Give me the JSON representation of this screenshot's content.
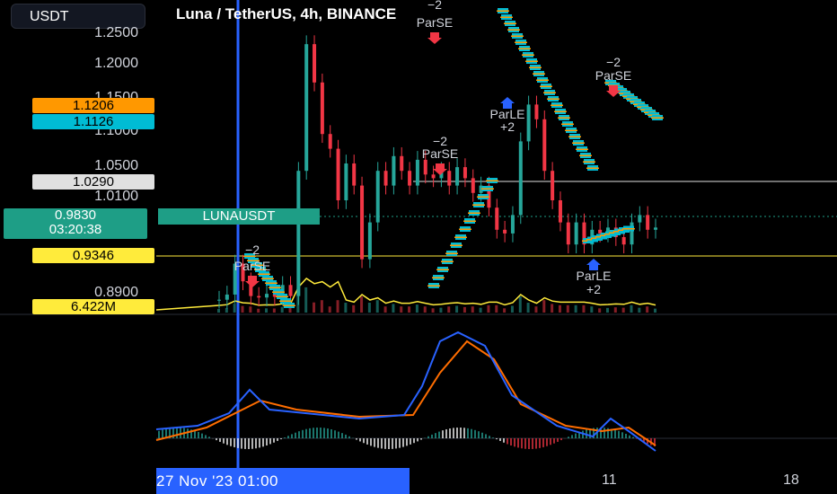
{
  "header": {
    "currency_button": "USDT",
    "title": "Luna / TetherUS, 4h, BINANCE"
  },
  "price_axis": {
    "ticks": [
      "1.2500",
      "1.2000",
      "1.1500",
      "1.1000",
      "1.0500",
      "1.0100",
      "0.8900"
    ],
    "badges": [
      {
        "label": "1.1206",
        "bg": "#ff9800",
        "fg": "#000000"
      },
      {
        "label": "1.1126",
        "bg": "#00bcd4",
        "fg": "#000000"
      },
      {
        "label": "1.0290",
        "bg": "#e0e0e0",
        "fg": "#000000"
      },
      {
        "label": "0.9346",
        "bg": "#ffeb3b",
        "fg": "#000000"
      },
      {
        "label": "6.422M",
        "bg": "#ffeb3b",
        "fg": "#000000"
      }
    ],
    "last_price": "0.9830",
    "countdown": "03:20:38",
    "symbol_tag": "LUNAUSDT"
  },
  "time_axis": {
    "cursor_label": "27 Nov '23   01:00",
    "ticks": [
      "11",
      "18"
    ]
  },
  "signals": [
    {
      "text": "−2",
      "sub": "ParSE",
      "type": "short"
    },
    {
      "text": "−2",
      "sub": "ParSE",
      "type": "short"
    },
    {
      "text": "ParLE",
      "sub": "+2",
      "type": "long"
    },
    {
      "text": "−2",
      "sub": "ParSE",
      "type": "short"
    },
    {
      "text": "−2",
      "sub": "ParSE",
      "type": "short"
    },
    {
      "text": "ParLE",
      "sub": "+2",
      "type": "long"
    }
  ],
  "colors": {
    "up": "#26a69a",
    "down": "#f23645",
    "sar": "#00bcd4",
    "sar_alt": "#ff9800",
    "volume_ma": "#ffeb3b",
    "macd": "#2962ff",
    "signal_line": "#ff6d00",
    "cursor": "#2962ff",
    "hline_price": "#ffeb3b",
    "hline_ref": "#e0e0e0"
  },
  "chart_data": {
    "type": "line",
    "title": "Luna / TetherUS, 4h, BINANCE",
    "ylim": [
      0.87,
      1.27
    ],
    "series": [
      {
        "name": "LUNAUSDT",
        "x": [
          1,
          2,
          3,
          4,
          5,
          6,
          7,
          8,
          9,
          10,
          11,
          12,
          13,
          14,
          15,
          16,
          17,
          18,
          19,
          20,
          21,
          22,
          23,
          24,
          25,
          26,
          27,
          28,
          29,
          30,
          31,
          32,
          33,
          34,
          35,
          36,
          37,
          38,
          39,
          40,
          41,
          42,
          43,
          44,
          45,
          46,
          47,
          48,
          49,
          50,
          51,
          52,
          53,
          54,
          55,
          56
        ],
        "values": [
          0.885,
          0.892,
          0.934,
          0.91,
          0.89,
          0.888,
          0.893,
          0.889,
          0.905,
          0.89,
          1.06,
          1.232,
          1.18,
          1.11,
          1.09,
          1.02,
          1.07,
          1.04,
          0.94,
          0.99,
          1.06,
          1.04,
          1.08,
          1.06,
          1.04,
          1.075,
          1.055,
          1.05,
          1.06,
          1.04,
          1.065,
          1.05,
          1.03,
          1.04,
          1.01,
          0.98,
          0.975,
          1.0,
          1.1,
          1.15,
          1.13,
          1.06,
          1.02,
          0.99,
          0.96,
          0.99,
          0.96,
          0.98,
          0.975,
          0.983,
          0.97,
          0.96,
          0.99,
          1.0,
          0.98,
          0.983
        ]
      }
    ]
  }
}
